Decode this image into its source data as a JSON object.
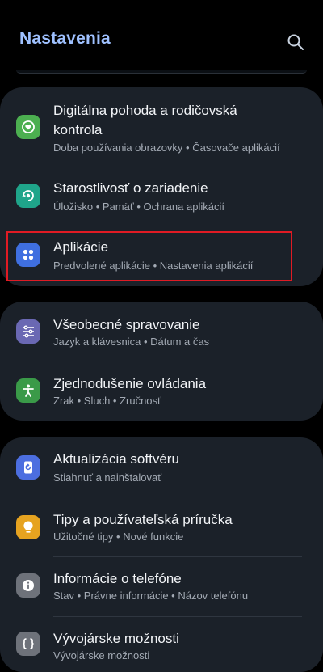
{
  "header": {
    "title": "Nastavenia",
    "search_icon": "search-icon"
  },
  "colors": {
    "background": "#000000",
    "card": "#1b2129",
    "title": "#9fc1ff",
    "highlight": "#e01b24"
  },
  "sections": [
    {
      "items": [
        {
          "label_line1": "Digitálna pohoda a rodičovská",
          "label_line2": "kontrola",
          "subtitle": "Doba používania obrazovky • Časovače aplikácií",
          "icon": "wellbeing-icon",
          "icon_color": "#4caf50"
        },
        {
          "label": "Starostlivosť o zariadenie",
          "subtitle": "Úložisko • Pamäť • Ochrana aplikácií",
          "icon": "device-care-icon",
          "icon_color": "#1fa58a"
        },
        {
          "label": "Aplikácie",
          "subtitle": "Predvolené aplikácie • Nastavenia aplikácií",
          "icon": "apps-icon",
          "icon_color": "#3f6fe0",
          "highlighted": true
        }
      ]
    },
    {
      "items": [
        {
          "label": "Všeobecné spravovanie",
          "subtitle": "Jazyk a klávesnica • Dátum a čas",
          "icon": "sliders-icon",
          "icon_color": "#6a68b3"
        },
        {
          "label": "Zjednodušenie ovládania",
          "subtitle": "Zrak • Sluch • Zručnosť",
          "icon": "accessibility-icon",
          "icon_color": "#3a9a48"
        }
      ]
    },
    {
      "items": [
        {
          "label": "Aktualizácia softvéru",
          "subtitle": "Stiahnuť a nainštalovať",
          "icon": "software-update-icon",
          "icon_color": "#4c6ee0"
        },
        {
          "label": "Tipy a používateľská príručka",
          "subtitle": "Užitočné tipy • Nové funkcie",
          "icon": "lightbulb-icon",
          "icon_color": "#e6a320"
        },
        {
          "label": "Informácie o telefóne",
          "subtitle": "Stav • Právne informácie • Názov telefónu",
          "icon": "info-icon",
          "icon_color": "#6e727a"
        },
        {
          "label": "Vývojárske možnosti",
          "subtitle": "Vývojárske možnosti",
          "icon": "developer-icon",
          "icon_color": "#6e727a"
        }
      ]
    }
  ]
}
